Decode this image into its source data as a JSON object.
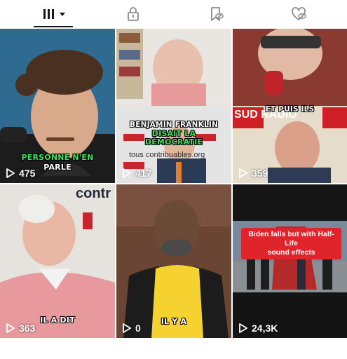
{
  "tabs": [
    {
      "icon": "grid-icon",
      "active": true,
      "has_dropdown": true
    },
    {
      "icon": "lock-icon",
      "active": false
    },
    {
      "icon": "bookmark-hidden-icon",
      "active": false
    },
    {
      "icon": "heart-hidden-icon",
      "active": false
    }
  ],
  "videos": [
    {
      "views": "475",
      "captions": [
        "PERSONNE N'EN",
        "PARLE"
      ],
      "bg": "#2a5f85"
    },
    {
      "views": "417",
      "captions": [
        "BENJAMIN FRANKLIN",
        "DISAIT LA",
        "DÉMOCRATIE"
      ],
      "bg_text": "tous contribuables.org",
      "bg": "#d9d9d9"
    },
    {
      "views": "359",
      "captions": [
        "ET PUIS ILS"
      ],
      "bg_text": "SUD RADIO",
      "bg": "#7a2a1f"
    },
    {
      "views": "363",
      "captions": [
        "IL A DIT"
      ],
      "bg_text": "contr",
      "bg": "#e8e4de"
    },
    {
      "views": "0",
      "captions": [
        "IL Y A"
      ],
      "bg": "#5a3a2a"
    },
    {
      "views": "24,3K",
      "captions": [
        "Biden falls but with Half-Life",
        "sound effects"
      ],
      "bg": "#2a2a30"
    }
  ]
}
